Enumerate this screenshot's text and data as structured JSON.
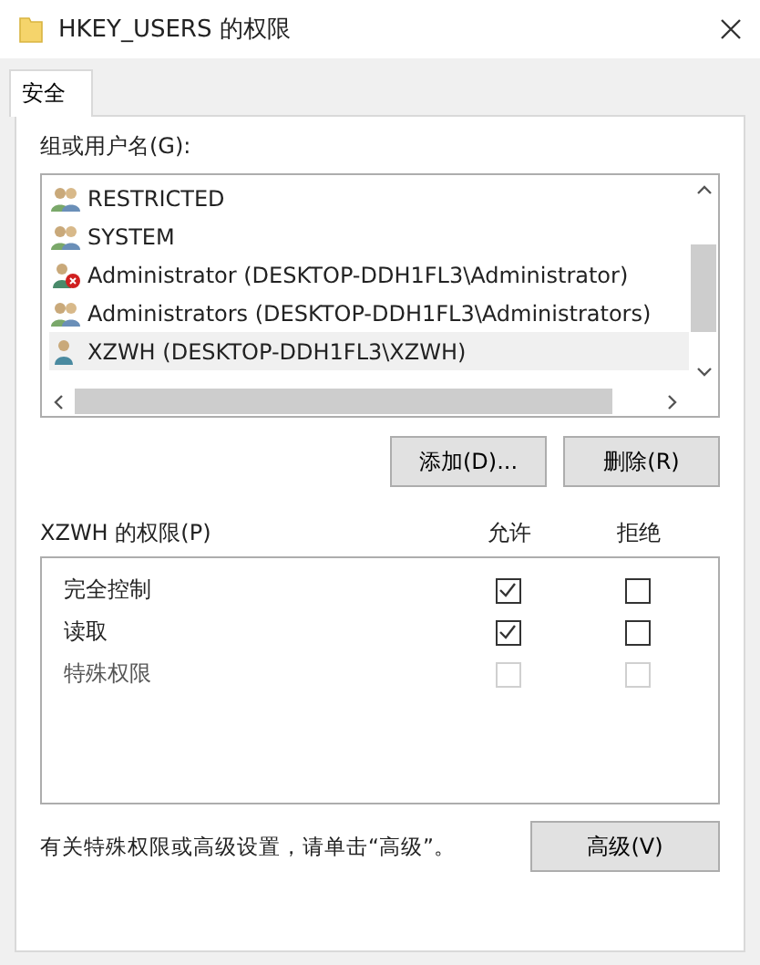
{
  "window": {
    "title": "HKEY_USERS 的权限"
  },
  "tabs": [
    {
      "label": "安全",
      "selected": true
    }
  ],
  "users_label": "组或用户名(G):",
  "users": [
    {
      "name": "RESTRICTED",
      "kind": "group",
      "selected": false
    },
    {
      "name": "SYSTEM",
      "kind": "group",
      "selected": false
    },
    {
      "name": "Administrator (DESKTOP-DDH1FL3\\Administrator)",
      "kind": "user-error",
      "selected": false
    },
    {
      "name": "Administrators (DESKTOP-DDH1FL3\\Administrators)",
      "kind": "group",
      "selected": false
    },
    {
      "name": "XZWH (DESKTOP-DDH1FL3\\XZWH)",
      "kind": "user",
      "selected": true
    }
  ],
  "user_buttons": [
    "添加(D)...",
    "删除(R)"
  ],
  "permissions": {
    "label": "XZWH 的权限(P)",
    "allow_heading": "允许",
    "deny_heading": "拒绝",
    "rows": [
      {
        "name": "完全控制",
        "allow": true,
        "deny": false,
        "disabled": false
      },
      {
        "name": "读取",
        "allow": true,
        "deny": false,
        "disabled": false
      },
      {
        "name": "特殊权限",
        "allow": false,
        "deny": false,
        "disabled": true
      }
    ]
  },
  "advanced_note": "有关特殊权限或高级设置，请单击“高级”。",
  "advanced_button": "高级(V)"
}
